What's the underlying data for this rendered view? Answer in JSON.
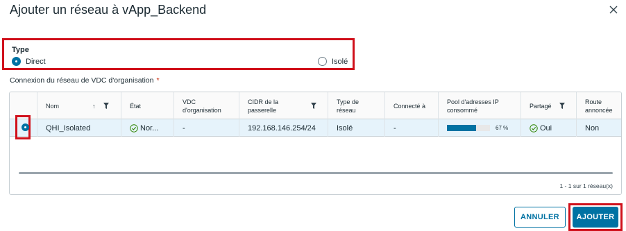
{
  "dialog": {
    "title": "Ajouter un réseau à vApp_Backend",
    "close_icon": "close-icon"
  },
  "type_section": {
    "label": "Type",
    "options": [
      {
        "label": "Direct",
        "selected": true
      },
      {
        "label": "Isolé",
        "selected": false
      }
    ]
  },
  "connection": {
    "label": "Connexion du réseau de VDC d'organisation",
    "required_marker": "*"
  },
  "grid": {
    "columns": [
      {
        "label": "Nom",
        "sortable": true,
        "filterable": true
      },
      {
        "label": "État"
      },
      {
        "label": "VDC d'organisation"
      },
      {
        "label": "CIDR de la passerelle",
        "filterable": true
      },
      {
        "label": "Type de réseau"
      },
      {
        "label": "Connecté à"
      },
      {
        "label": "Pool d'adresses IP consommé"
      },
      {
        "label": "Partagé",
        "filterable": true
      },
      {
        "label": "Route annoncée"
      }
    ],
    "rows": [
      {
        "selected": true,
        "name": "QHI_Isolated",
        "state": "Nor...",
        "vdc": "-",
        "cidr": "192.168.146.254/24",
        "network_type": "Isolé",
        "connected_to": "-",
        "pool_percent": 67,
        "pool_text": "67 %",
        "shared": "Oui",
        "route": "Non"
      }
    ],
    "footer": "1 - 1 sur 1 réseau(x)"
  },
  "buttons": {
    "cancel": "ANNULER",
    "add": "AJOUTER"
  },
  "colors": {
    "accent": "#0072a3",
    "highlight_box": "#d0101b",
    "success": "#2f8400"
  }
}
